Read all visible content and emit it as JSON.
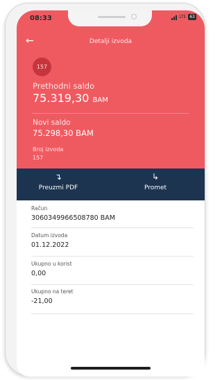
{
  "status_bar": {
    "time": "08:33",
    "network": "LTE",
    "battery": "63"
  },
  "header": {
    "back_icon": "arrow-left-icon",
    "title": "Detalji izvoda"
  },
  "summary": {
    "badge": "157",
    "previous_balance_label": "Prethodni saldo",
    "previous_balance_value": "75.319,30",
    "previous_balance_currency": "BAM",
    "new_balance_label": "Novi saldo",
    "new_balance_value": "75.298,30 BAM",
    "statement_number_label": "Broj izvoda",
    "statement_number_value": "157"
  },
  "actions": {
    "download_pdf_icon": "download-icon",
    "download_pdf_label": "Preuzmi PDF",
    "transactions_icon": "forward-arrow-icon",
    "transactions_label": "Promet"
  },
  "details": {
    "account_label": "Račun",
    "account_value": "3060349966508780 BAM",
    "date_label": "Datum izvoda",
    "date_value": "01.12.2022",
    "credit_label": "Ukupno u korist",
    "credit_value": "0,00",
    "debit_label": "Ukupno na teret",
    "debit_value": "-21,00"
  },
  "colors": {
    "header_background": "#ef5a61",
    "action_bar_background": "#1c3450",
    "badge_background": "#c6353d"
  }
}
